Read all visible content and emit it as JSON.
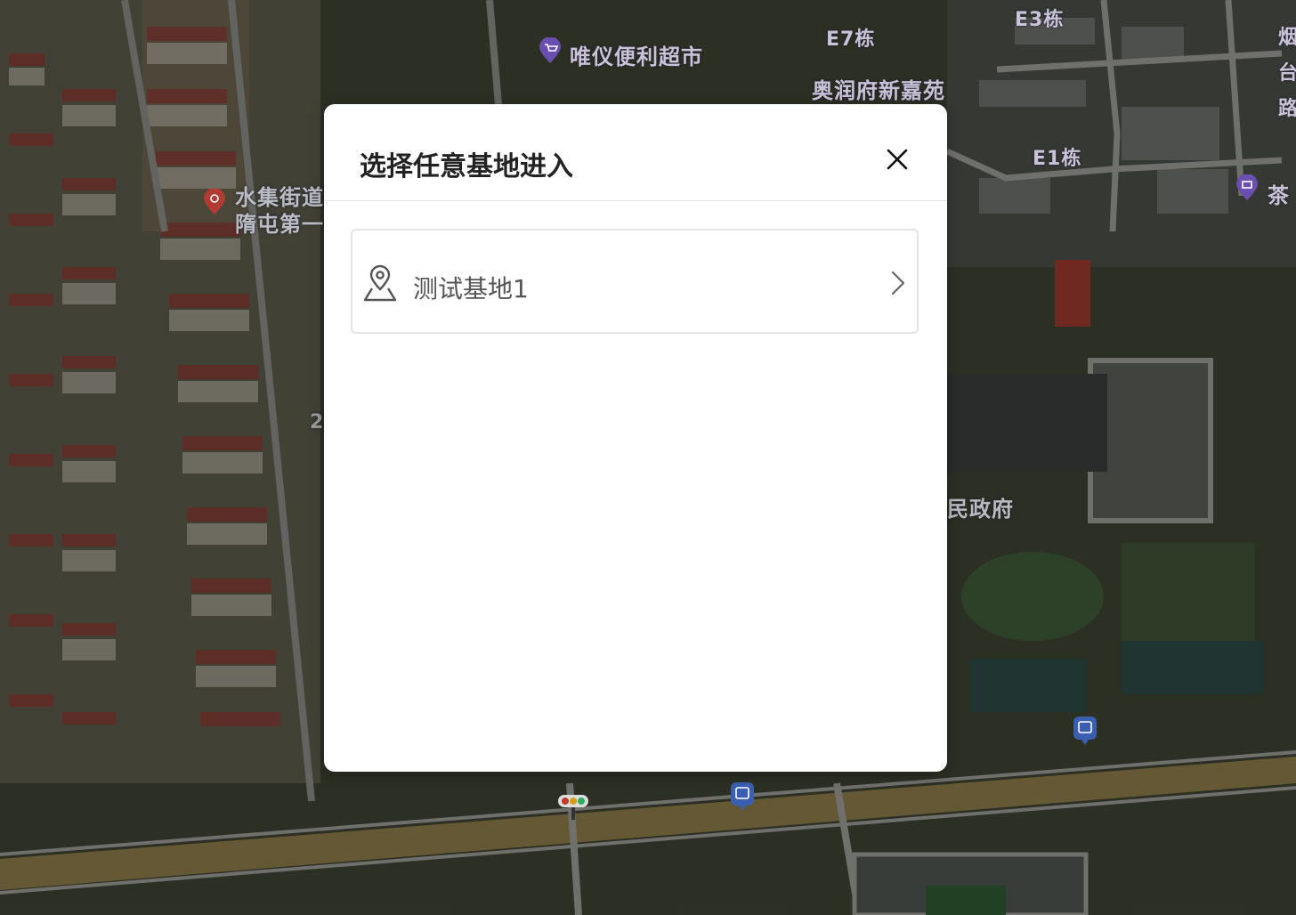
{
  "map": {
    "labels": [
      {
        "id": "poi-store",
        "text": "唯仪便利超市"
      },
      {
        "id": "bld-e7",
        "text": "E7栋"
      },
      {
        "id": "bld-e3",
        "text": "E3栋"
      },
      {
        "id": "complex",
        "text": "奥润府新嘉苑"
      },
      {
        "id": "bld-e1",
        "text": "E1栋"
      },
      {
        "id": "poi-clinic-1",
        "text": "水集街道"
      },
      {
        "id": "poi-clinic-2",
        "text": "隋屯第一"
      },
      {
        "id": "gov",
        "text": "民政府"
      },
      {
        "id": "edge-right-1",
        "text": "烟"
      },
      {
        "id": "edge-right-2",
        "text": "台"
      },
      {
        "id": "edge-right-3",
        "text": "路"
      },
      {
        "id": "tea",
        "text": "茶"
      },
      {
        "id": "num-2",
        "text": "2"
      }
    ],
    "icons": [
      "shopping-cart-pin-icon",
      "clinic-pin-icon",
      "bus-stop-icon",
      "traffic-light-icon",
      "tea-shop-pin-icon"
    ]
  },
  "modal": {
    "title": "选择任意基地进入",
    "close_icon": "close-icon",
    "items": [
      {
        "label": "测试基地1",
        "icon": "location-pin-icon",
        "trailing_icon": "chevron-right-icon"
      }
    ]
  },
  "colors": {
    "overlay": "rgba(0,0,0,0.28)",
    "modal_bg": "#ffffff",
    "title": "#222222",
    "item_text": "#555555",
    "item_border": "#e4e4e4",
    "map_label": "#c9c2d8"
  }
}
